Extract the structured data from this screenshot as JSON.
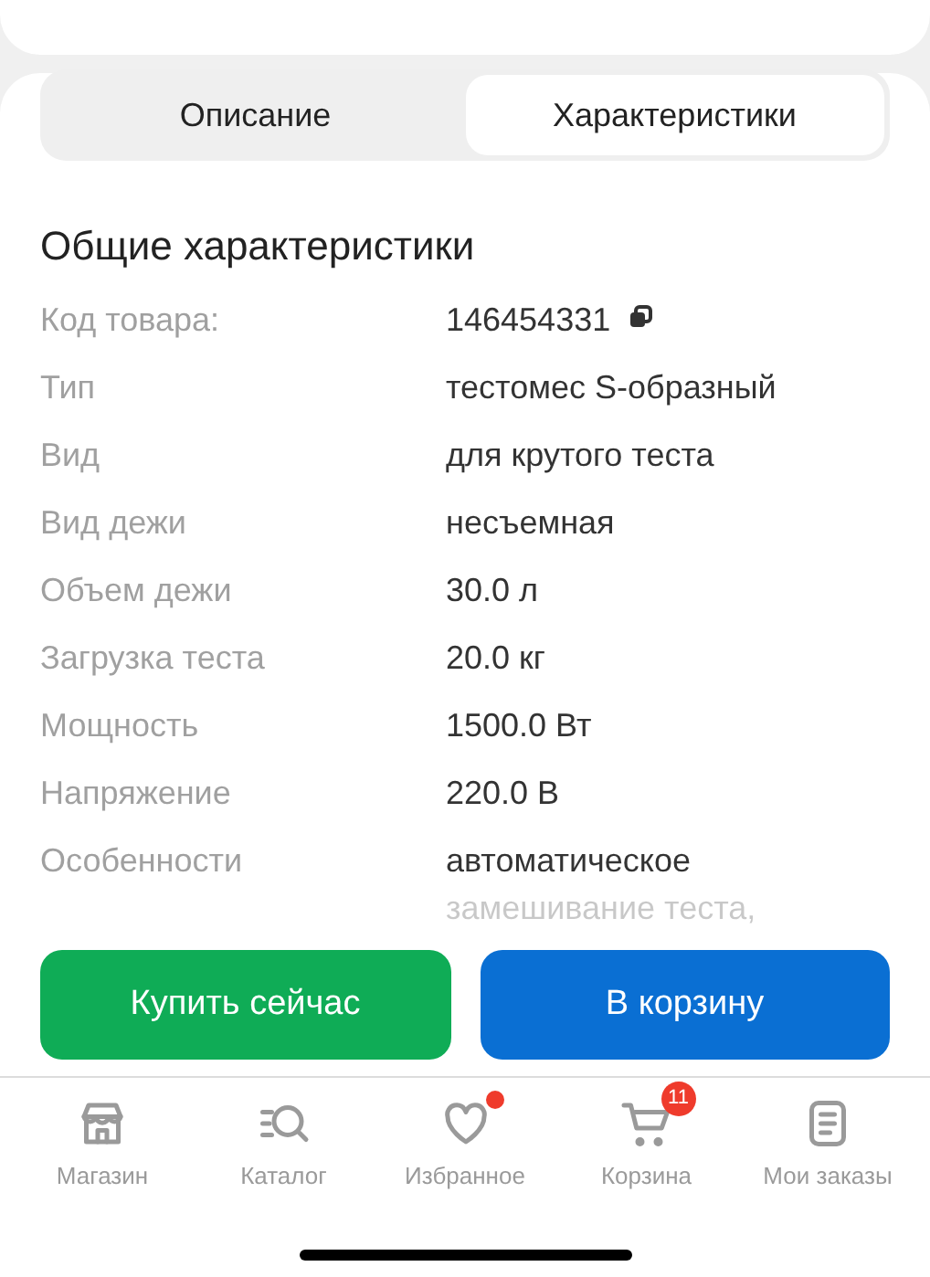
{
  "tabs": [
    {
      "label": "Описание",
      "selected": false
    },
    {
      "label": "Характеристики",
      "selected": true
    }
  ],
  "section_title": "Общие характеристики",
  "specs": [
    {
      "name": "Код товара:",
      "value": "146454331",
      "copyable": true
    },
    {
      "name": "Тип",
      "value": "тестомес S-образный",
      "copyable": false
    },
    {
      "name": "Вид",
      "value": "для крутого теста",
      "copyable": false
    },
    {
      "name": "Вид дежи",
      "value": "несъемная",
      "copyable": false
    },
    {
      "name": "Объем дежи",
      "value": "30.0 л",
      "copyable": false
    },
    {
      "name": "Загрузка теста",
      "value": "20.0 кг",
      "copyable": false
    },
    {
      "name": "Мощность",
      "value": "1500.0 Вт",
      "copyable": false
    },
    {
      "name": "Напряжение",
      "value": "220.0 В",
      "copyable": false
    },
    {
      "name": "Особенности",
      "value": "автоматическое замешивание теста,",
      "copyable": false,
      "faded": true
    }
  ],
  "buttons": [
    {
      "label": "Купить сейчас",
      "kind": "buy"
    },
    {
      "label": "В корзину",
      "kind": "cart"
    }
  ],
  "nav": [
    {
      "label": "Магазин",
      "kind": "store",
      "dot": false
    },
    {
      "label": "Каталог",
      "kind": "catalog",
      "dot": false
    },
    {
      "label": "Избранное",
      "kind": "favorites",
      "dot": true
    },
    {
      "label": "Корзина",
      "kind": "cart",
      "dot": false,
      "badge": "11"
    },
    {
      "label": "Мои заказы",
      "kind": "orders",
      "dot": false
    }
  ]
}
